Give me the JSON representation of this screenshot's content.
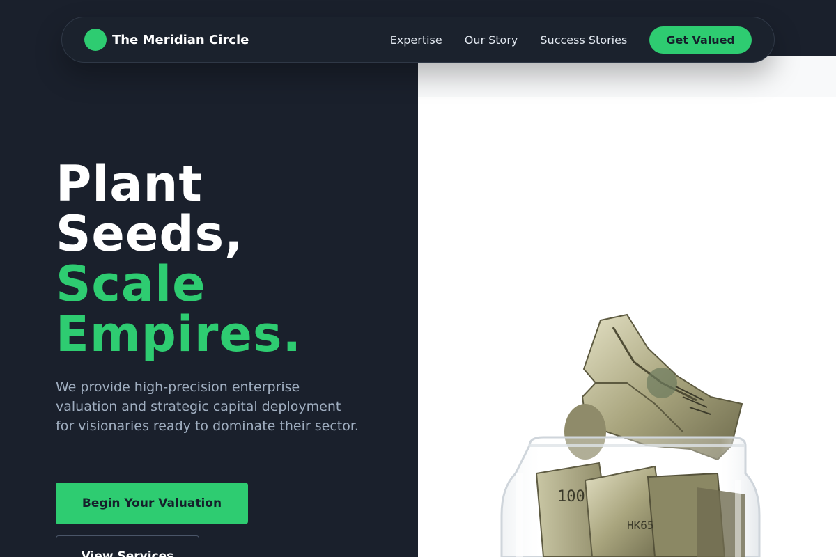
{
  "nav": {
    "brand": "The Meridian Circle",
    "links": [
      "Expertise",
      "Our Story",
      "Success Stories"
    ],
    "cta": "Get Valued"
  },
  "hero": {
    "headline_line1": "Plant",
    "headline_line2": "Seeds,",
    "headline_line3": "Scale",
    "headline_line4": "Empires.",
    "subtext": "We provide high-precision enterprise valuation and strategic capital deployment for visionaries ready to dominate their sector.",
    "primary_button": "Begin Your Valuation",
    "secondary_button": "View Services"
  },
  "colors": {
    "background": "#1a202c",
    "accent": "#2ecc71",
    "panel": "#ffffff"
  },
  "visual": {
    "image_description_icon": "money-jar-image"
  }
}
